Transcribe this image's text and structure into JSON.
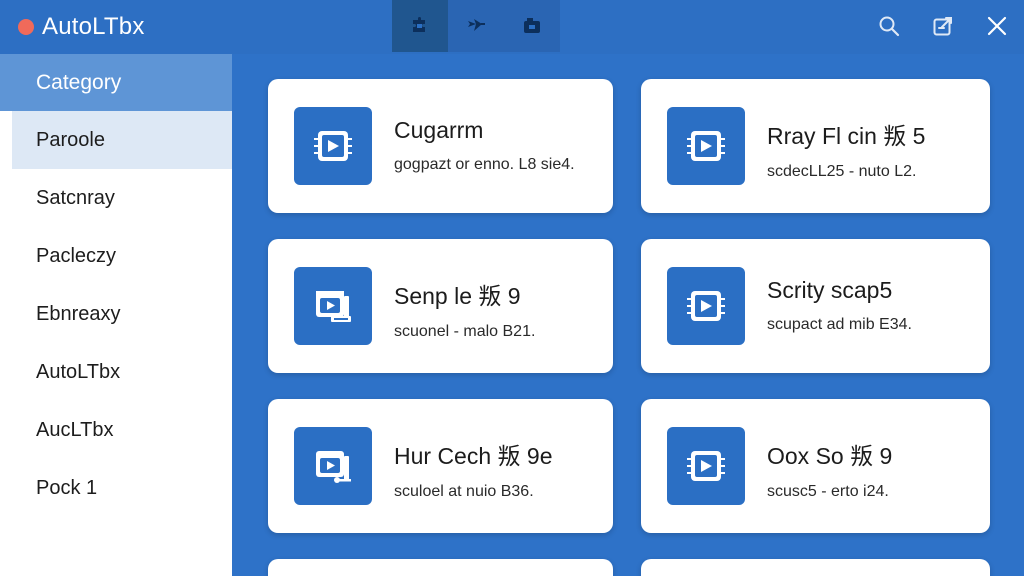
{
  "app": {
    "title": "AutoLTbx",
    "accent": "#2d6fc3",
    "dot_color": "#f06a5a"
  },
  "toolbar": {
    "buttons": [
      {
        "icon": "puzzle-icon",
        "active": true
      },
      {
        "icon": "plugin-icon",
        "active": false
      },
      {
        "icon": "package-icon",
        "active": false
      }
    ]
  },
  "window_controls": [
    {
      "icon": "search-icon"
    },
    {
      "icon": "export-icon"
    },
    {
      "icon": "close-icon"
    }
  ],
  "sidebar": {
    "header": "Category",
    "items": [
      {
        "label": "Paroole",
        "selected": true
      },
      {
        "label": "Satcnray",
        "selected": false
      },
      {
        "label": "Pacleczy",
        "selected": false
      },
      {
        "label": "Ebnreaxy",
        "selected": false
      },
      {
        "label": "AutoLTbx",
        "selected": false
      },
      {
        "label": "AucLTbx",
        "selected": false
      },
      {
        "label": "Pock 1",
        "selected": false
      }
    ]
  },
  "cards": [
    {
      "title": "Cugarrm",
      "subtitle": "gogpazt or enno. L8 sie4.",
      "icon": "tool-chip-icon"
    },
    {
      "title": "Rray Fl cin 叛 5",
      "subtitle": "scdecLL25 - nuto L2.",
      "icon": "tool-chip-icon"
    },
    {
      "title": "Senp le 叛 9",
      "subtitle": "scuonel - malo B21.",
      "icon": "video-window-icon"
    },
    {
      "title": "Scrity scap5",
      "subtitle": "scupact ad mib E34.",
      "icon": "tool-chip-icon"
    },
    {
      "title": "Hur Cech 叛 9e",
      "subtitle": "sculoel at nuio B36.",
      "icon": "video-window-icon"
    },
    {
      "title": "Oox So 叛 9",
      "subtitle": "scusc5 - erto i24.",
      "icon": "tool-chip-icon"
    }
  ]
}
